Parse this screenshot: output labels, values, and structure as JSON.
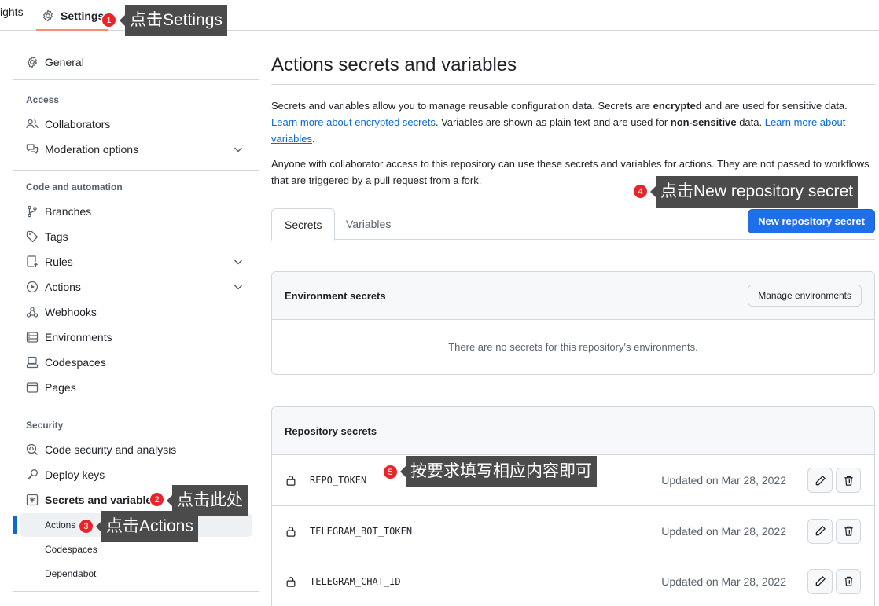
{
  "topnav": {
    "insights_label": "ights",
    "settings_label": "Settings"
  },
  "sidebar": {
    "general": "General",
    "access_heading": "Access",
    "collaborators": "Collaborators",
    "moderation": "Moderation options",
    "code_heading": "Code and automation",
    "branches": "Branches",
    "tags": "Tags",
    "rules": "Rules",
    "actions": "Actions",
    "webhooks": "Webhooks",
    "environments": "Environments",
    "codespaces": "Codespaces",
    "pages": "Pages",
    "security_heading": "Security",
    "code_security": "Code security and analysis",
    "deploy_keys": "Deploy keys",
    "secrets_vars": "Secrets and variables",
    "sub_actions": "Actions",
    "sub_codespaces": "Codespaces",
    "sub_dependabot": "Dependabot"
  },
  "main": {
    "title": "Actions secrets and variables",
    "desc1_a": "Secrets and variables allow you to manage reusable configuration data. Secrets are ",
    "desc1_b": "encrypted",
    "desc1_c": " and are used for sensitive data. ",
    "desc1_link1": "Learn more about encrypted secrets",
    "desc1_d": ". Variables are shown as plain text and are used for ",
    "desc1_e": "non-sensitive",
    "desc1_f": " data. ",
    "desc1_link2": "Learn more about variables",
    "desc1_g": ".",
    "desc2": "Anyone with collaborator access to this repository can use these secrets and variables for actions. They are not passed to workflows that are triggered by a pull request from a fork.",
    "tab_secrets": "Secrets",
    "tab_variables": "Variables",
    "new_secret_button": "New repository secret",
    "env_heading": "Environment secrets",
    "manage_env_button": "Manage environments",
    "env_empty": "There are no secrets for this repository's environments.",
    "repo_heading": "Repository secrets",
    "secrets": [
      {
        "name": "REPO_TOKEN",
        "updated": "Updated on Mar 28, 2022"
      },
      {
        "name": "TELEGRAM_BOT_TOKEN",
        "updated": "Updated on Mar 28, 2022"
      },
      {
        "name": "TELEGRAM_CHAT_ID",
        "updated": "Updated on Mar 28, 2022"
      }
    ]
  },
  "annotations": [
    {
      "num": "1",
      "text": "点击Settings"
    },
    {
      "num": "2",
      "text": "点击此处"
    },
    {
      "num": "3",
      "text": "点击Actions"
    },
    {
      "num": "4",
      "text": "点击New repository secret"
    },
    {
      "num": "5",
      "text": "按要求填写相应内容即可"
    }
  ],
  "colors": {
    "accent": "#1f6feb",
    "badge": "#e8262a",
    "callout": "#4b4b4b",
    "tab_underline": "#fd8c73"
  }
}
